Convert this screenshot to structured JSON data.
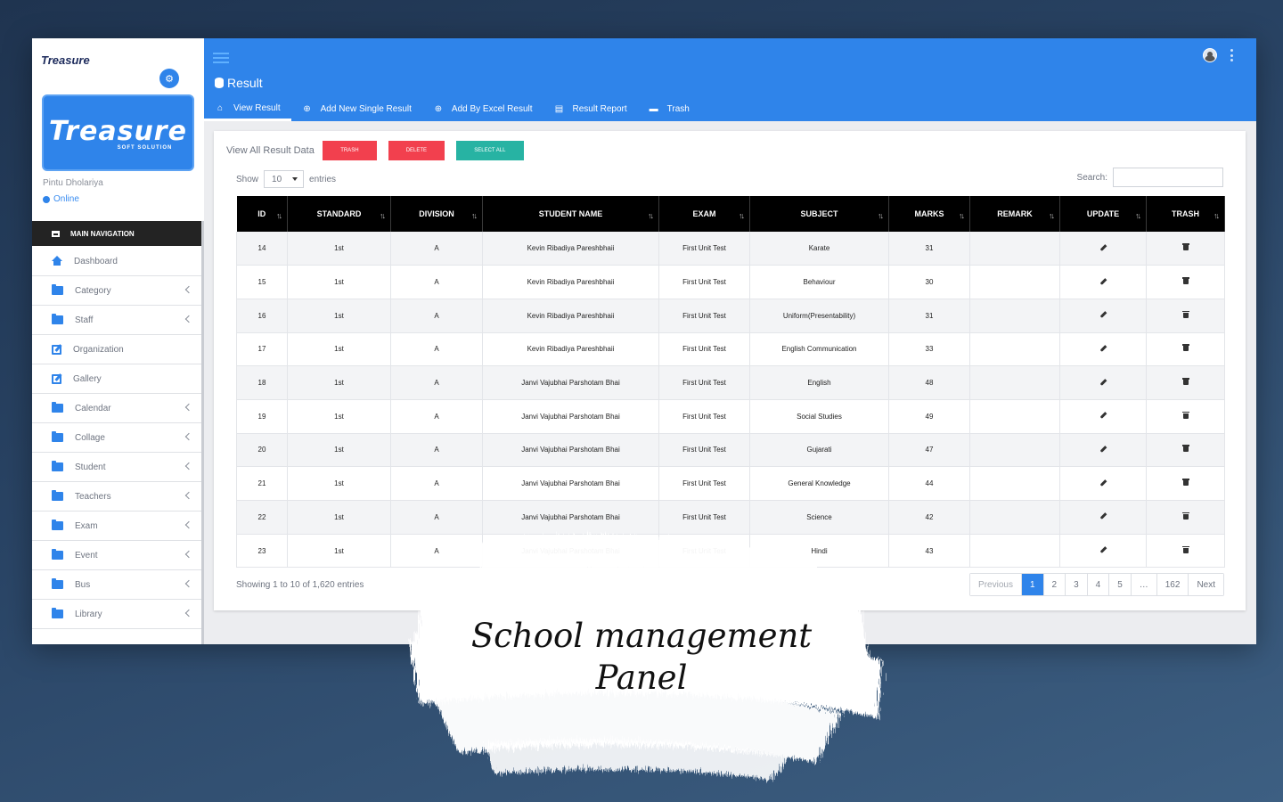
{
  "sidebar": {
    "logo_text": "Treasure",
    "brand_title": "Treasure",
    "brand_subtitle": "SOFT SOLUTION",
    "user_name": "Pintu Dholariya",
    "user_status": "Online",
    "section_label": "MAIN NAVIGATION",
    "items": [
      {
        "label": "Dashboard",
        "icon": "home-icon",
        "has_arrow": false
      },
      {
        "label": "Category",
        "icon": "folder-icon",
        "has_arrow": true
      },
      {
        "label": "Staff",
        "icon": "folder-icon",
        "has_arrow": true
      },
      {
        "label": "Organization",
        "icon": "edit-icon",
        "has_arrow": false
      },
      {
        "label": "Gallery",
        "icon": "edit-icon",
        "has_arrow": false
      },
      {
        "label": "Calendar",
        "icon": "folder-icon",
        "has_arrow": true
      },
      {
        "label": "Collage",
        "icon": "folder-icon",
        "has_arrow": true
      },
      {
        "label": "Student",
        "icon": "folder-icon",
        "has_arrow": true
      },
      {
        "label": "Teachers",
        "icon": "folder-icon",
        "has_arrow": true
      },
      {
        "label": "Exam",
        "icon": "folder-icon",
        "has_arrow": true
      },
      {
        "label": "Event",
        "icon": "folder-icon",
        "has_arrow": true
      },
      {
        "label": "Bus",
        "icon": "folder-icon",
        "has_arrow": true
      },
      {
        "label": "Library",
        "icon": "folder-icon",
        "has_arrow": true
      }
    ]
  },
  "header": {
    "title": "Result",
    "tabs": [
      {
        "label": "View Result",
        "icon": "home-icon",
        "active": true
      },
      {
        "label": "Add New Single Result",
        "icon": "plus-circle-icon",
        "active": false
      },
      {
        "label": "Add By Excel Result",
        "icon": "plus-circle-icon",
        "active": false
      },
      {
        "label": "Result Report",
        "icon": "pdf-icon",
        "active": false
      },
      {
        "label": "Trash",
        "icon": "truck-icon",
        "active": false
      }
    ]
  },
  "panel": {
    "title": "View All Result Data",
    "trash_button": "TRASH",
    "delete_button": "DELETE",
    "select_all_button": "SELECT ALL",
    "show_label": "Show",
    "page_length": "10",
    "entries_label": "entries",
    "search_label": "Search:",
    "search_value": "",
    "info": "Showing 1 to 10 of 1,620 entries"
  },
  "table": {
    "columns": [
      "ID",
      "STANDARD",
      "DIVISION",
      "STUDENT NAME",
      "EXAM",
      "SUBJECT",
      "MARKS",
      "REMARK",
      "UPDATE",
      "TRASH"
    ],
    "rows": [
      [
        "14",
        "1st",
        "A",
        "Kevin Ribadiya Pareshbhaii",
        "First Unit Test",
        "Karate",
        "31",
        ""
      ],
      [
        "15",
        "1st",
        "A",
        "Kevin Ribadiya Pareshbhaii",
        "First Unit Test",
        "Behaviour",
        "30",
        ""
      ],
      [
        "16",
        "1st",
        "A",
        "Kevin Ribadiya Pareshbhaii",
        "First Unit Test",
        "Uniform(Presentability)",
        "31",
        ""
      ],
      [
        "17",
        "1st",
        "A",
        "Kevin Ribadiya Pareshbhaii",
        "First Unit Test",
        "English Communication",
        "33",
        ""
      ],
      [
        "18",
        "1st",
        "A",
        "Janvi Vajubhai Parshotam Bhai",
        "First Unit Test",
        "English",
        "48",
        ""
      ],
      [
        "19",
        "1st",
        "A",
        "Janvi Vajubhai Parshotam Bhai",
        "First Unit Test",
        "Social Studies",
        "49",
        ""
      ],
      [
        "20",
        "1st",
        "A",
        "Janvi Vajubhai Parshotam Bhai",
        "First Unit Test",
        "Gujarati",
        "47",
        ""
      ],
      [
        "21",
        "1st",
        "A",
        "Janvi Vajubhai Parshotam Bhai",
        "First Unit Test",
        "General Knowledge",
        "44",
        ""
      ],
      [
        "22",
        "1st",
        "A",
        "Janvi Vajubhai Parshotam Bhai",
        "First Unit Test",
        "Science",
        "42",
        ""
      ],
      [
        "23",
        "1st",
        "A",
        "Janvi Vajubhai Parshotam Bhai",
        "First Unit Test",
        "Hindi",
        "43",
        ""
      ]
    ]
  },
  "pagination": {
    "previous": "Previous",
    "pages": [
      "1",
      "2",
      "3",
      "4",
      "5",
      "…",
      "162"
    ],
    "active_page": "1",
    "next": "Next"
  },
  "overlay": {
    "caption_line1": "School management",
    "caption_line2": "Panel"
  },
  "colors": {
    "primary": "#2f84ea",
    "danger": "#f2404e",
    "teal": "#27b3a3",
    "header_dark": "#000000"
  }
}
